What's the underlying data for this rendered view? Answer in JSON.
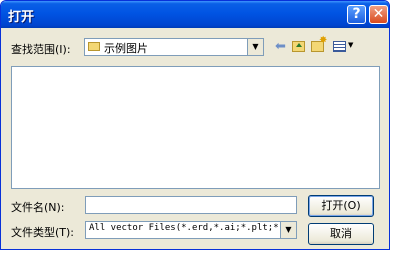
{
  "window": {
    "title": "打开"
  },
  "lookin": {
    "label": "查找范围(I):",
    "value": "示例图片"
  },
  "toolbar": {
    "icons": [
      "back-arrow",
      "up-folder",
      "new-folder",
      "view-menu"
    ]
  },
  "filename": {
    "label": "文件名(N):",
    "value": ""
  },
  "filetype": {
    "label": "文件类型(T):",
    "value": "All vector Files(*.erd,*.ai;*.plt;*."
  },
  "buttons": {
    "open": "打开(O)",
    "cancel": "取消"
  },
  "colors": {
    "titlebar": "#0054e3",
    "dialog": "#ece9d8",
    "close": "#d94a1e"
  }
}
